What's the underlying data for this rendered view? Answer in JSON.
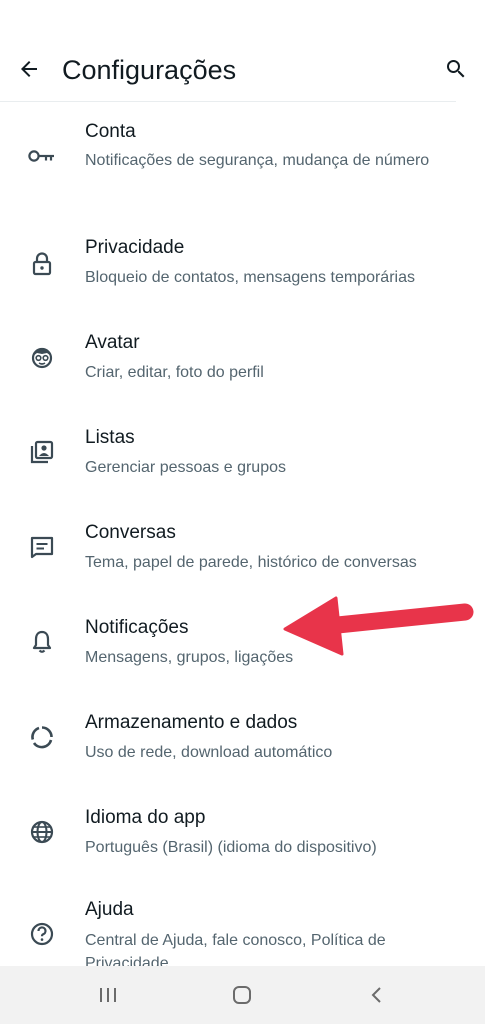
{
  "header": {
    "title": "Configurações"
  },
  "items": [
    {
      "title": "Conta",
      "subtitle": "Notificações de segurança, mudança de número",
      "icon": "key-icon"
    },
    {
      "title": "Privacidade",
      "subtitle": "Bloqueio de contatos, mensagens temporárias",
      "icon": "lock-icon"
    },
    {
      "title": "Avatar",
      "subtitle": "Criar, editar, foto do perfil",
      "icon": "avatar-face-icon"
    },
    {
      "title": "Listas",
      "subtitle": "Gerenciar pessoas e grupos",
      "icon": "contacts-list-icon"
    },
    {
      "title": "Conversas",
      "subtitle": "Tema, papel de parede, histórico de conversas",
      "icon": "chat-icon"
    },
    {
      "title": "Notificações",
      "subtitle": "Mensagens, grupos, ligações",
      "icon": "bell-icon"
    },
    {
      "title": "Armazenamento e dados",
      "subtitle": "Uso de rede, download automático",
      "icon": "storage-ring-icon"
    },
    {
      "title": "Idioma do app",
      "subtitle": "Português (Brasil) (idioma do dispositivo)",
      "icon": "globe-icon"
    },
    {
      "title": "Ajuda",
      "subtitle": "Central de Ajuda, fale conosco, Política de Privacidade",
      "icon": "help-icon"
    }
  ],
  "annotation": {
    "color": "#e8344a",
    "points_to": "Notificações"
  },
  "colors": {
    "text_primary": "#111b21",
    "text_secondary": "#54656f",
    "icon": "#3b4a54",
    "navbar": "#f2f2f2"
  }
}
